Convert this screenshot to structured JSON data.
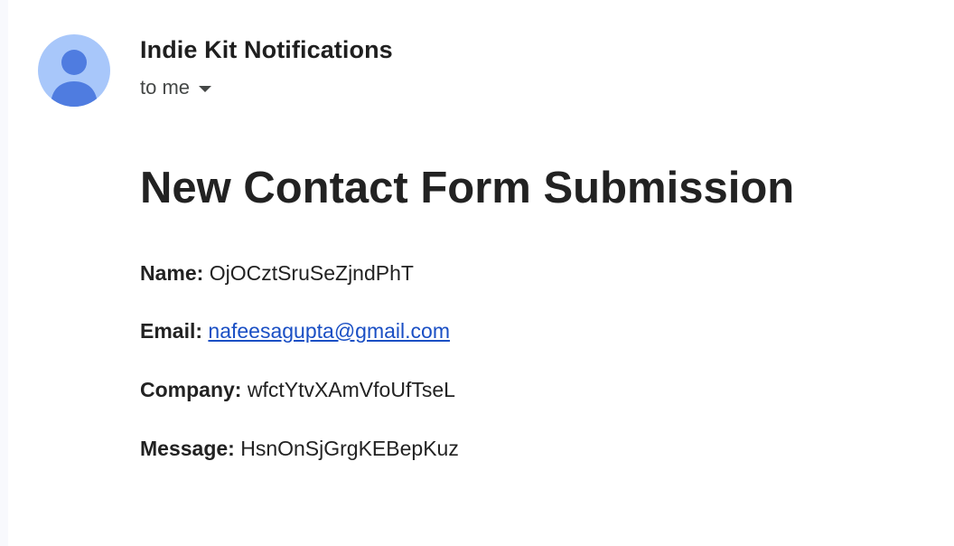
{
  "header": {
    "sender_name": "Indie Kit Notifications",
    "recipient_text": "to me",
    "avatar_icon": "person-avatar-icon",
    "dropdown_icon": "caret-down-icon"
  },
  "email": {
    "title": "New Contact Form Submission",
    "fields": [
      {
        "label": "Name:",
        "value": "OjOCztSruSeZjndPhT"
      },
      {
        "label": "Email:",
        "value": "nafeesagupta@gmail.com",
        "link": true
      },
      {
        "label": "Company:",
        "value": "wfctYtvXAmVfoUfTseL"
      },
      {
        "label": "Message:",
        "value": "HsnOnSjGrgKEBepKuz"
      }
    ]
  },
  "colors": {
    "avatar_bg": "#a8c7fa",
    "avatar_figure": "#4f7ce0",
    "link": "#1a4fc4",
    "text": "#222222",
    "muted_text": "#444746"
  }
}
